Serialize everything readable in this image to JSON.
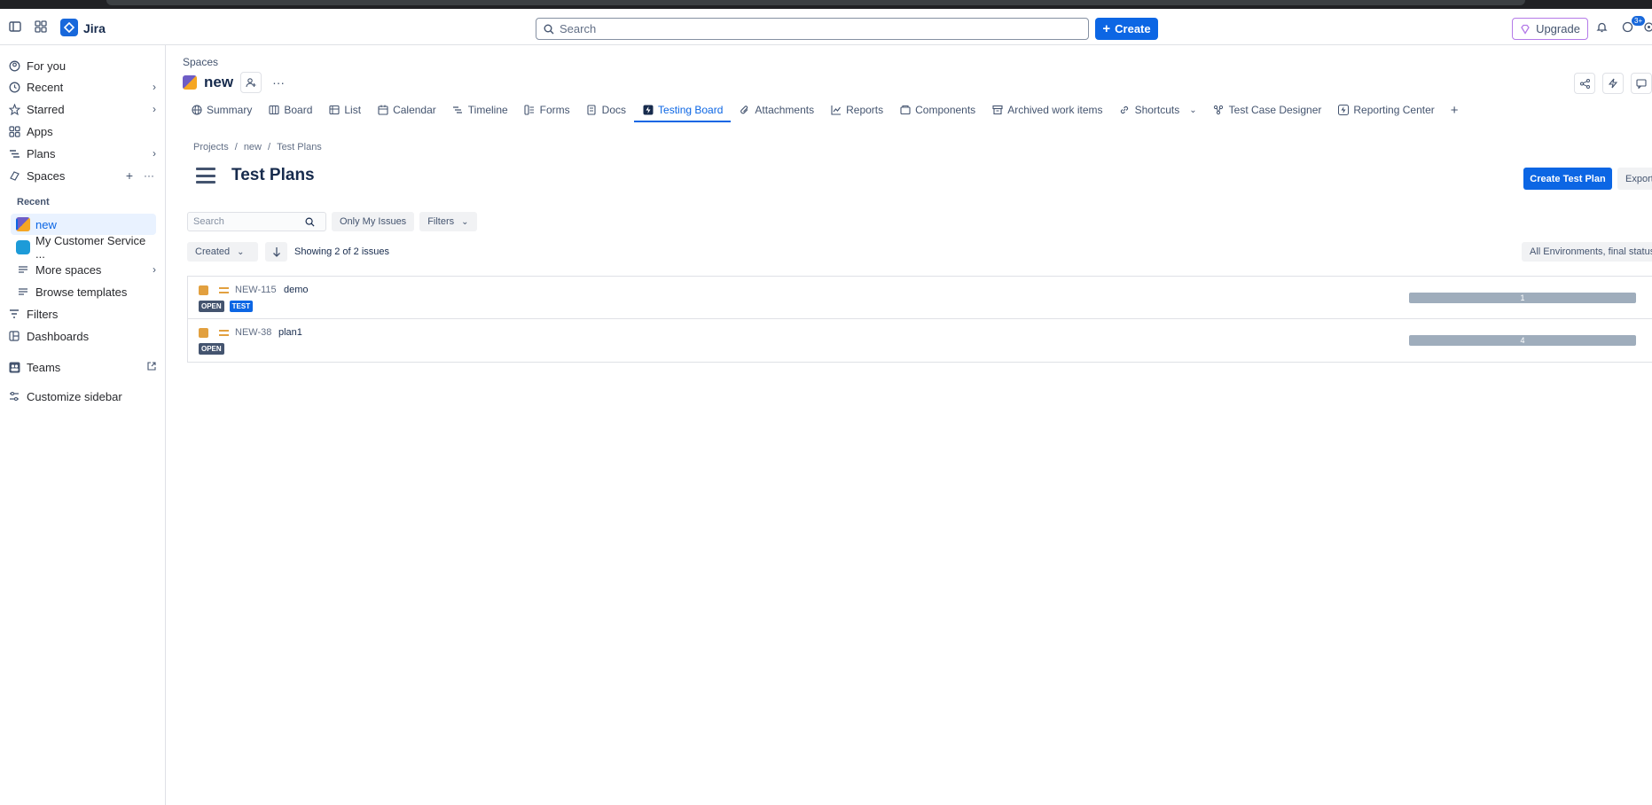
{
  "topbar": {
    "app_name": "Jira",
    "search_placeholder": "Search",
    "create_label": "Create",
    "upgrade_label": "Upgrade",
    "notif_badge": "3+"
  },
  "sidebar": {
    "items": [
      {
        "label": "For you",
        "icon": "user-circle-icon"
      },
      {
        "label": "Recent",
        "icon": "clock-icon"
      },
      {
        "label": "Starred",
        "icon": "star-icon"
      },
      {
        "label": "Apps",
        "icon": "apps-icon"
      },
      {
        "label": "Plans",
        "icon": "plans-icon"
      },
      {
        "label": "Spaces",
        "icon": "spaces-icon"
      }
    ],
    "recent_heading": "Recent",
    "recent_items": [
      {
        "label": "new"
      },
      {
        "label": "My Customer Service ..."
      }
    ],
    "more_spaces": "More spaces",
    "browse_templates": "Browse templates",
    "filters": "Filters",
    "dashboards": "Dashboards",
    "teams": "Teams",
    "customize": "Customize sidebar"
  },
  "space": {
    "crumb": "Spaces",
    "name": "new"
  },
  "tabs": [
    {
      "label": "Summary",
      "icon": "globe-icon"
    },
    {
      "label": "Board",
      "icon": "board-icon"
    },
    {
      "label": "List",
      "icon": "list-icon"
    },
    {
      "label": "Calendar",
      "icon": "calendar-icon"
    },
    {
      "label": "Timeline",
      "icon": "timeline-icon"
    },
    {
      "label": "Forms",
      "icon": "forms-icon"
    },
    {
      "label": "Docs",
      "icon": "docs-icon"
    },
    {
      "label": "Testing Board",
      "icon": "lightning-icon"
    },
    {
      "label": "Attachments",
      "icon": "paperclip-icon"
    },
    {
      "label": "Reports",
      "icon": "chart-line-icon"
    },
    {
      "label": "Components",
      "icon": "components-icon"
    },
    {
      "label": "Archived work items",
      "icon": "archive-icon"
    },
    {
      "label": "Shortcuts",
      "icon": "link-icon"
    },
    {
      "label": "Test Case Designer",
      "icon": "tcd-icon"
    },
    {
      "label": "Reporting Center",
      "icon": "lightning-icon"
    }
  ],
  "breadcrumb": [
    "Projects",
    "/",
    "new",
    "/",
    "Test Plans"
  ],
  "page": {
    "title": "Test Plans",
    "create_plan": "Create Test Plan",
    "export": "Export",
    "search_placeholder": "Search",
    "only_my": "Only My Issues",
    "filters": "Filters",
    "sort_by": "Created",
    "showing": "Showing 2 of 2 issues",
    "env_filter": "All Environments, final status"
  },
  "issues": [
    {
      "key": "NEW-115",
      "summary": "demo",
      "lozenges": [
        "OPEN",
        "TEST"
      ],
      "progress": "1"
    },
    {
      "key": "NEW-38",
      "summary": "plan1",
      "lozenges": [
        "OPEN"
      ],
      "progress": "4"
    }
  ],
  "colors": {
    "accent": "#0c66e4",
    "issue_type": "#e2a03f",
    "progress_bar": "#9fadbc"
  }
}
